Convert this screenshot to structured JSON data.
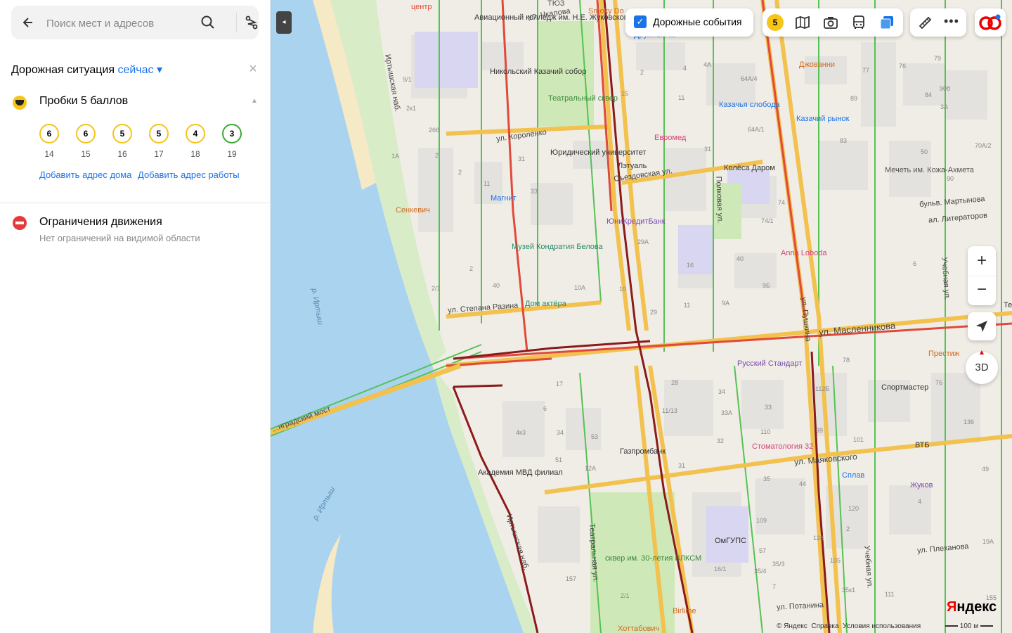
{
  "search": {
    "placeholder": "Поиск мест и адресов"
  },
  "traffic": {
    "title": "Дорожная ситуация",
    "time_link": "сейчас",
    "jams_label": "Пробки 5 баллов",
    "forecast": [
      {
        "score": "6",
        "hour": "14"
      },
      {
        "score": "6",
        "hour": "15"
      },
      {
        "score": "5",
        "hour": "16"
      },
      {
        "score": "5",
        "hour": "17"
      },
      {
        "score": "4",
        "hour": "18"
      },
      {
        "score": "3",
        "hour": "19"
      }
    ],
    "add_home": "Добавить адрес дома",
    "add_work": "Добавить адрес работы"
  },
  "restrictions": {
    "title": "Ограничения движения",
    "subtitle": "Нет ограничений на видимой области"
  },
  "map_toolbar": {
    "events_label": "Дорожные события",
    "traffic_score": "5"
  },
  "map_controls": {
    "three_d": "3D"
  },
  "map_labels": {
    "pois": [
      "Авиационный колледж им. Н.Е. Жуковского",
      "Никольский Казачий собор",
      "Театральный сквер",
      "Юридический университет",
      "Лэтуаль",
      "Евромед",
      "Казачья слобода",
      "Казачий рынок",
      "Колёса Даром",
      "Мечеть им. Кожа-Ахмета",
      "Магнит",
      "Сенкевич",
      "ЮниКредитБанк",
      "Музей Кондратия Белова",
      "Anna Loboda",
      "Дом актёра",
      "Джованни",
      "Русский Стандарт",
      "Престиж",
      "Спортмастер",
      "Газпромбанк",
      "Стоматология 32",
      "ВТБ",
      "Академия МВД филиал",
      "Сплав",
      "Жуков",
      "ОмГУПС",
      "сквер им. 30-летия ВЛКСМ",
      "Birlime",
      "Хоттабович",
      "Smoky Do",
      "ТЮЗ",
      "центр",
      "Дружный ...",
      "Тепл..."
    ],
    "streets": [
      "ул. Чкалова",
      "Иртышская наб.",
      "ул. Короленко",
      "Съездовская ул.",
      "Полковая ул.",
      "ул. Степана Разина",
      "ул. Масленникова",
      "ул. Пушкина",
      "бульв. Мартынова",
      "ал. Литераторов",
      "Учебная ул.",
      "ул. Маяковского",
      "ул. Плеханова",
      "Учебная ул.",
      "ул. Потанина",
      "Театральная ул.",
      "Иртышская наб.",
      "...нградский мост",
      "р. Иртыш",
      "р. Иртыш"
    ],
    "house_numbers": [
      "9/1",
      "2к1",
      "266",
      "1А",
      "2",
      "2",
      "11",
      "31",
      "33",
      "2",
      "2/1",
      "40",
      "10А",
      "10",
      "29",
      "29А",
      "16",
      "11",
      "9Б",
      "9А",
      "40",
      "74",
      "74/1",
      "64А/1",
      "31",
      "2",
      "15",
      "11",
      "4А",
      "64А/4",
      "4",
      "89",
      "77",
      "76",
      "84",
      "79",
      "90б",
      "3А",
      "83",
      "70А/2",
      "50",
      "90",
      "17",
      "6",
      "34",
      "51",
      "53",
      "12А",
      "11/13",
      "33А",
      "32",
      "34",
      "28",
      "31",
      "33",
      "110",
      "112Б",
      "99",
      "101",
      "78",
      "76",
      "136",
      "49",
      "44",
      "120",
      "2",
      "4",
      "105",
      "109",
      "57",
      "35/4",
      "35/3",
      "7",
      "128",
      "35к1",
      "111",
      "19А",
      "155",
      "157",
      "2/1",
      "16/1",
      "35",
      "4к3",
      "6",
      "99"
    ]
  },
  "attribution": {
    "copyright": "© Яндекс",
    "help": "Справка",
    "terms": "Условия использования"
  },
  "scale": {
    "label": "100 м"
  },
  "logo": {
    "text_y": "Я",
    "text_rest": "ндекс"
  }
}
